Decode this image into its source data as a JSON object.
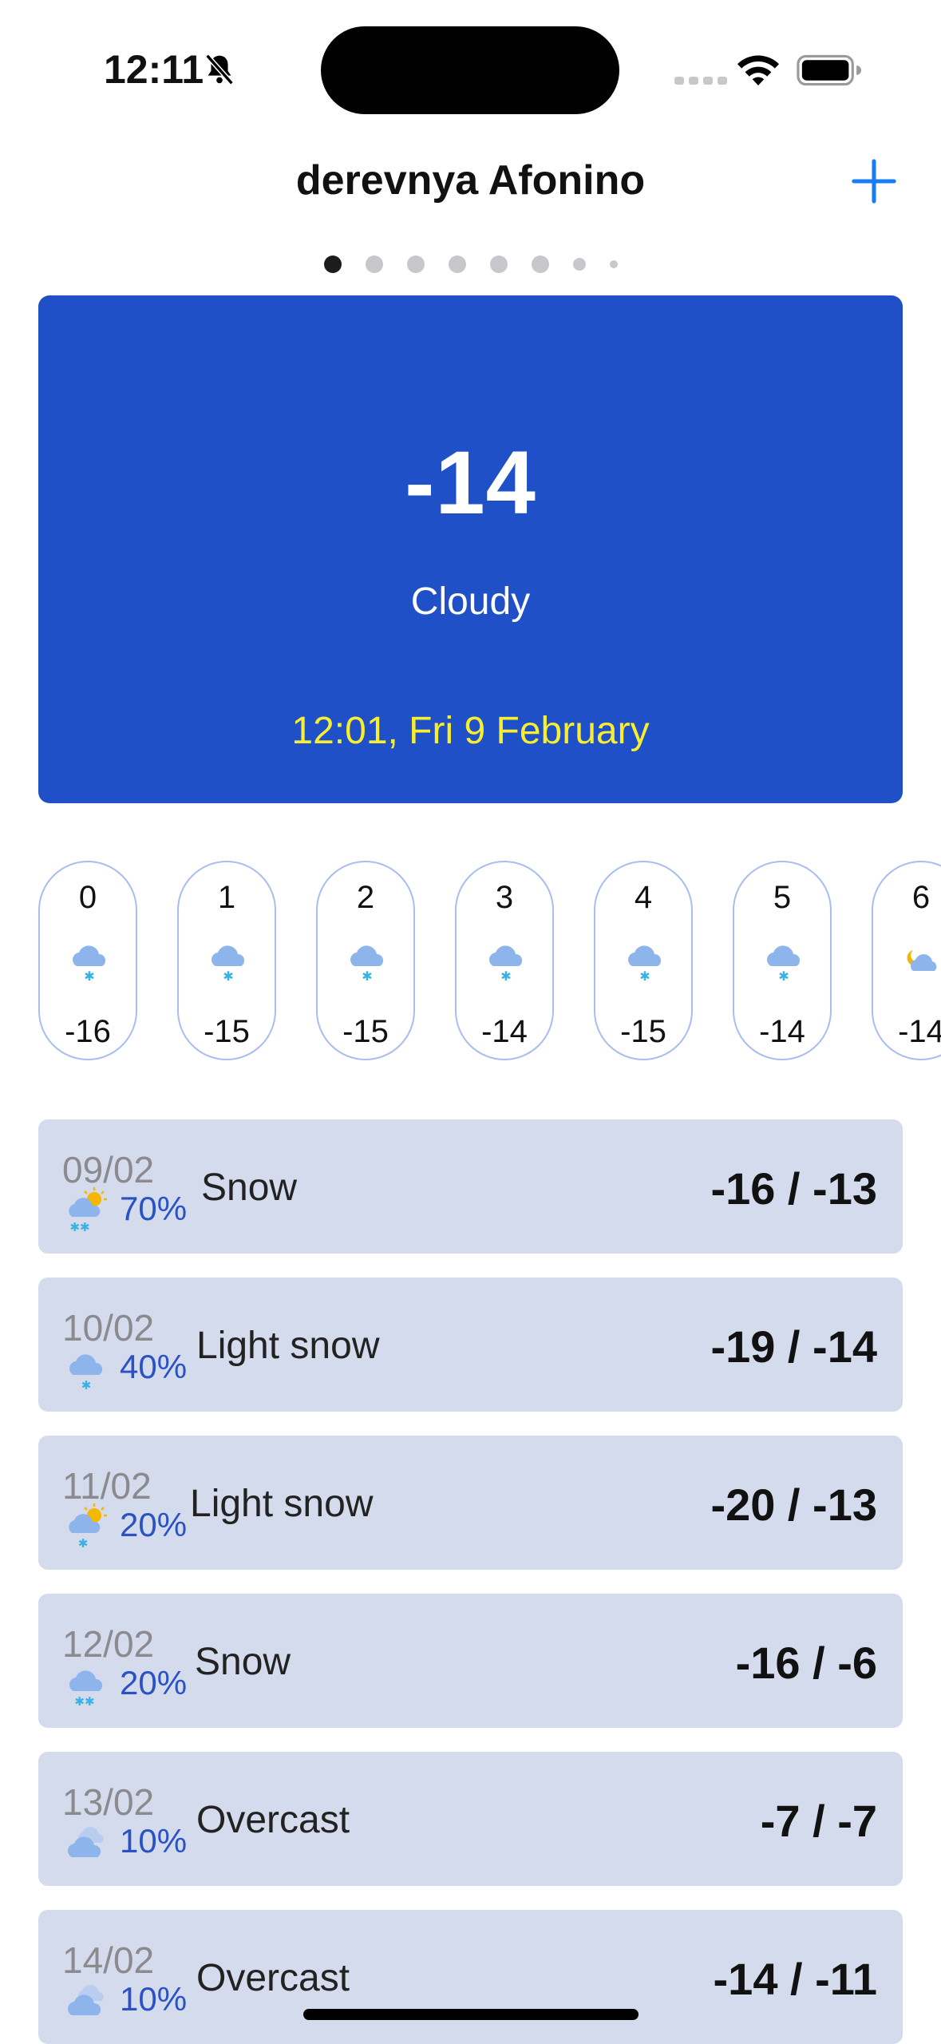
{
  "status_bar": {
    "time": "12:11"
  },
  "header": {
    "city": "derevnya Afonino",
    "page_count": 8,
    "active_page": 0
  },
  "current": {
    "temp": "-14",
    "condition": "Cloudy",
    "datetime": "12:01, Fri 9 February"
  },
  "hourly": [
    {
      "hour": "0",
      "temp": "-16",
      "icon": "snow-cloud-icon"
    },
    {
      "hour": "1",
      "temp": "-15",
      "icon": "snow-cloud-icon"
    },
    {
      "hour": "2",
      "temp": "-15",
      "icon": "snow-cloud-icon"
    },
    {
      "hour": "3",
      "temp": "-14",
      "icon": "snow-cloud-icon"
    },
    {
      "hour": "4",
      "temp": "-15",
      "icon": "snow-cloud-icon"
    },
    {
      "hour": "5",
      "temp": "-14",
      "icon": "snow-cloud-icon"
    },
    {
      "hour": "6",
      "temp": "-14",
      "icon": "moon-cloud-icon"
    }
  ],
  "daily": [
    {
      "date": "09/02",
      "precip": "70%",
      "desc": "Snow",
      "range": "-16 / -13",
      "icon": "sun-snow-cloud-icon"
    },
    {
      "date": "10/02",
      "precip": "40%",
      "desc": "Light snow",
      "range": "-19 / -14",
      "icon": "snow-cloud-icon"
    },
    {
      "date": "11/02",
      "precip": "20%",
      "desc": "Light snow",
      "range": "-20 / -13",
      "icon": "sun-snow-cloud-icon"
    },
    {
      "date": "12/02",
      "precip": "20%",
      "desc": "Snow",
      "range": "-16 / -6",
      "icon": "snow-cloud-icon"
    },
    {
      "date": "13/02",
      "precip": "10%",
      "desc": "Overcast",
      "range": "-7 / -7",
      "icon": "overcast-cloud-icon"
    },
    {
      "date": "14/02",
      "precip": "10%",
      "desc": "Overcast",
      "range": "-14 / -11",
      "icon": "overcast-cloud-icon"
    }
  ],
  "colors": {
    "accent": "#2050c8",
    "date_text": "#f6ee2e",
    "row_bg": "#d3dbec",
    "precip": "#2a52c4",
    "plus": "#1a7cf5"
  }
}
